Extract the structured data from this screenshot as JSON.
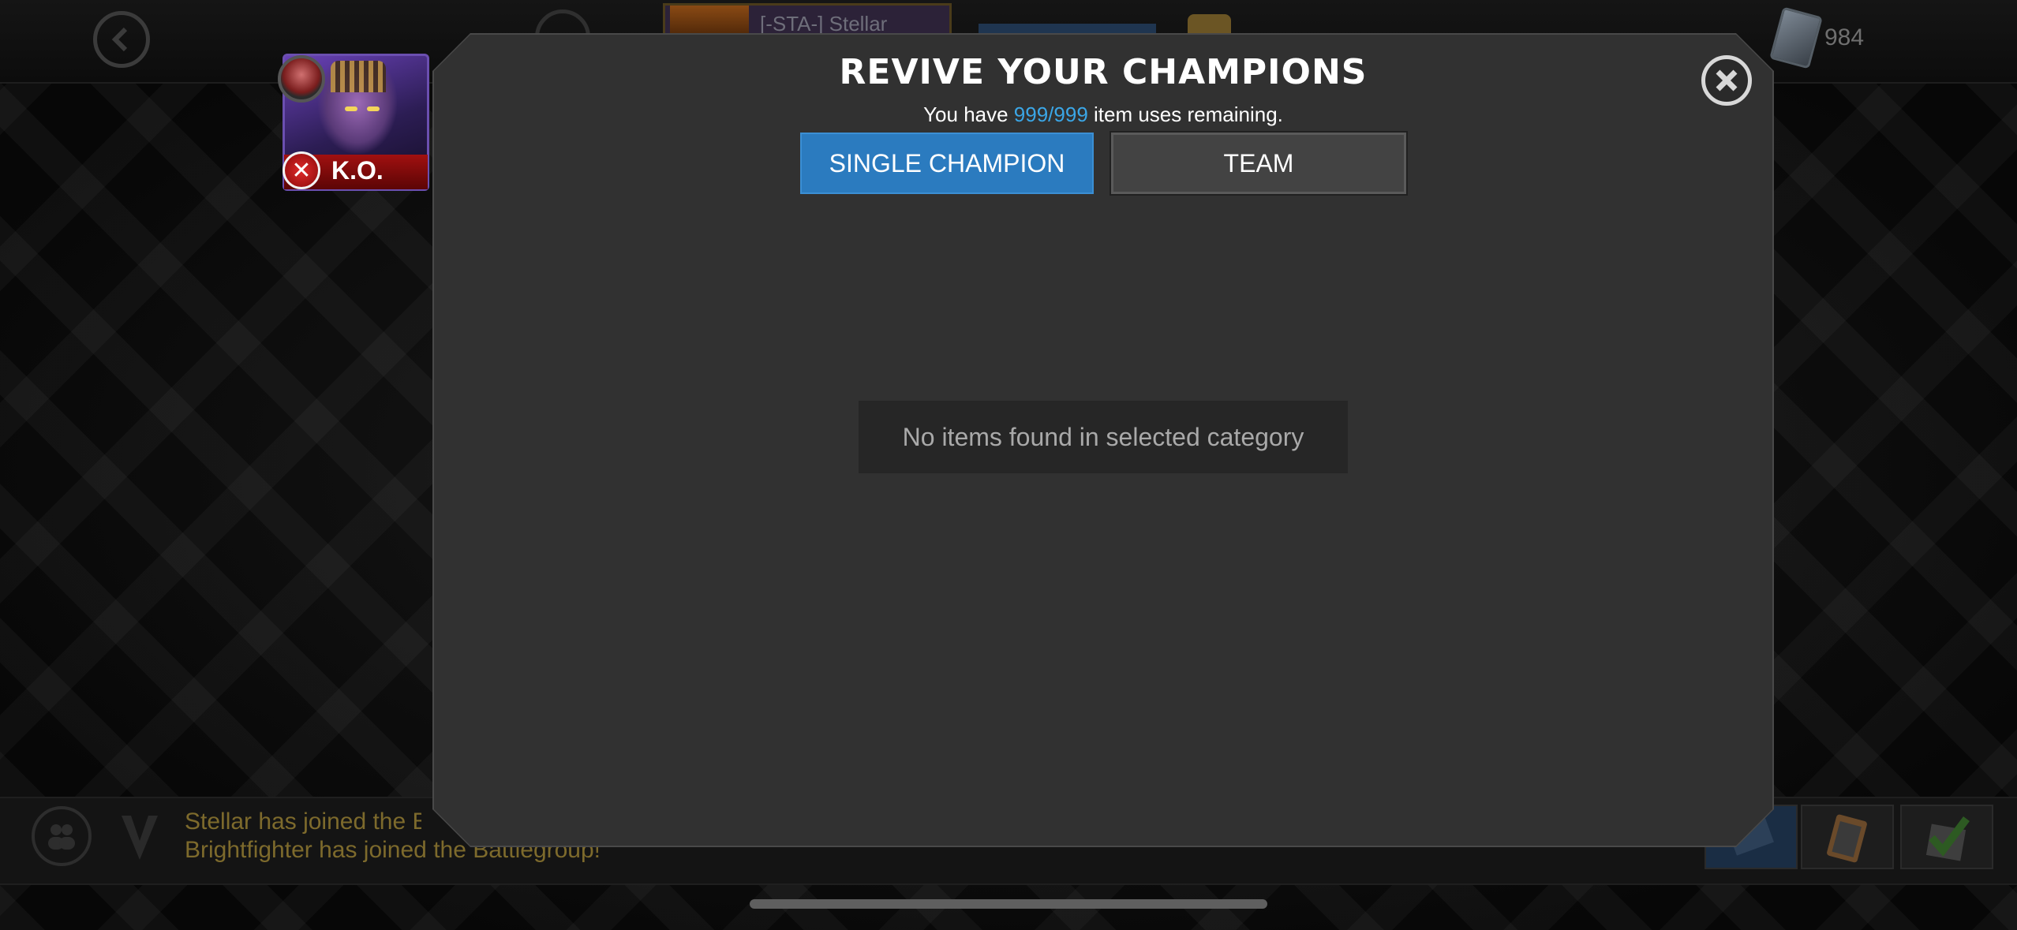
{
  "top_bar": {
    "champion_chip_name": "[-STA-] Stellar",
    "units_value": "984"
  },
  "ko_tile": {
    "status_label": "K.O."
  },
  "modal": {
    "title": "REVIVE YOUR CHAMPIONS",
    "subtitle_prefix": "You have ",
    "subtitle_count": "999/999",
    "subtitle_suffix": " item uses remaining.",
    "tabs": [
      {
        "label": "SINGLE CHAMPION",
        "active": true
      },
      {
        "label": "TEAM",
        "active": false
      }
    ],
    "empty_message": "No items found in selected category"
  },
  "bottom_bar": {
    "feed": [
      "Stellar has joined the Battlegroup!",
      "Brightfighter has joined the Battlegroup!"
    ]
  },
  "colors": {
    "accent_blue": "#2b7bbf",
    "highlight_blue": "#3ba6e6",
    "modal_bg": "#313131",
    "ko_red": "#a11010"
  },
  "icons": [
    "back-arrow-icon",
    "menu-icon",
    "units-card-icon",
    "close-icon",
    "ko-x-icon",
    "people-icon",
    "alliance-logo-icon",
    "quest-map-icon",
    "clipboard-icon",
    "checkmark-icon"
  ]
}
